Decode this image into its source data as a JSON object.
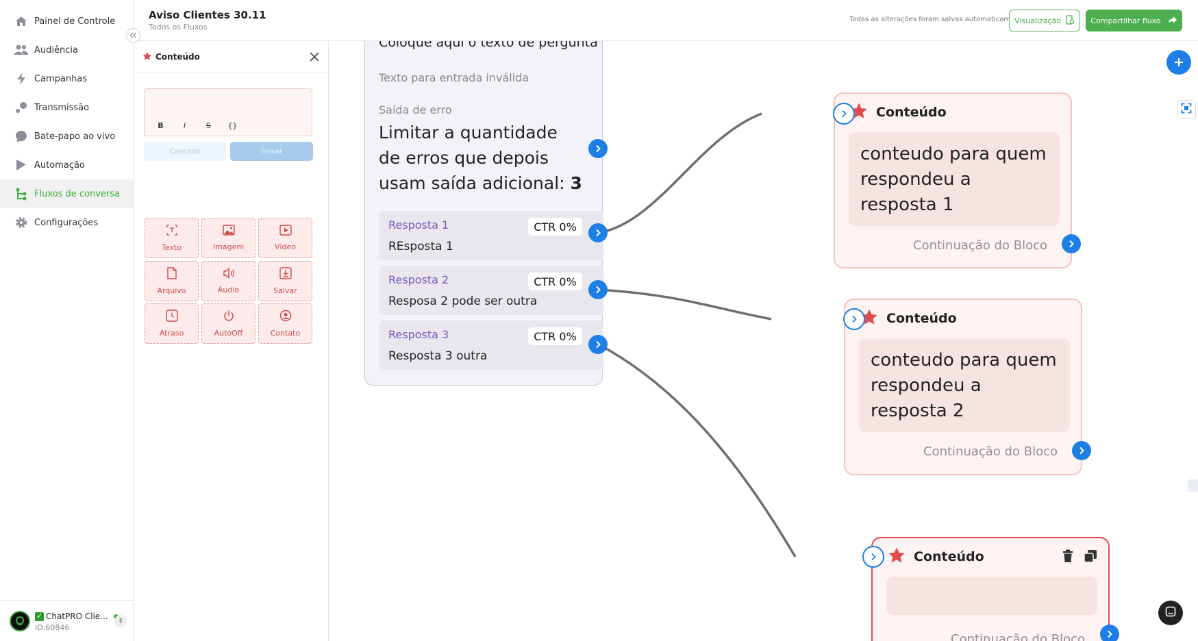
{
  "header": {
    "title": "Aviso Clientes 30.11",
    "breadcrumb": "Todos os Fluxos",
    "autosave": "Todas as alterações foram salvas automaticamente",
    "preview_label": "Visualização",
    "share_label": "Compartilhar fluxo"
  },
  "sidebar": {
    "items": [
      {
        "label": "Painel de Controle",
        "icon": "home-icon"
      },
      {
        "label": "Audiência",
        "icon": "people-icon"
      },
      {
        "label": "Campanhas",
        "icon": "bolt-icon"
      },
      {
        "label": "Transmissão",
        "icon": "broadcast-icon"
      },
      {
        "label": "Bate-papo ao vivo",
        "icon": "chat-bubble-icon"
      },
      {
        "label": "Automação",
        "icon": "play-flag-icon"
      },
      {
        "label": "Fluxos de conversa",
        "icon": "flow-icon",
        "active": true
      },
      {
        "label": "Configurações",
        "icon": "gear-icon"
      }
    ],
    "account": {
      "name": "ChatPRO Clie...",
      "id": "ID:60846",
      "status": "online"
    }
  },
  "panel": {
    "title": "Conteúdo",
    "editor_tools": [
      "B",
      "I",
      "S",
      "{}"
    ],
    "cancel_label": "Cancelar",
    "save_label": "Salvar",
    "blocks": [
      {
        "label": "Texto",
        "icon": "text-icon"
      },
      {
        "label": "Imagem",
        "icon": "image-icon"
      },
      {
        "label": "Vídeo",
        "icon": "video-icon"
      },
      {
        "label": "Arquivo",
        "icon": "file-icon"
      },
      {
        "label": "Áudio",
        "icon": "audio-icon"
      },
      {
        "label": "Salvar",
        "icon": "download-icon"
      },
      {
        "label": "Atraso",
        "icon": "clock-icon"
      },
      {
        "label": "AutoOff",
        "icon": "power-icon"
      },
      {
        "label": "Contato",
        "icon": "contact-icon"
      }
    ]
  },
  "question_card": {
    "question_text": "Coloque aqui o texto de pergunta",
    "invalid_text": "Texto para entrada inválida",
    "error_label": "Saída de erro",
    "limit_text": "Limitar a quantidade de erros que depois usam saída adicional:",
    "limit_value": "3",
    "answers": [
      {
        "name": "Resposta 1",
        "value": "REsposta 1",
        "ctr": "CTR 0%"
      },
      {
        "name": "Resposta 2",
        "value": "Resposa 2 pode ser outra",
        "ctr": "CTR 0%"
      },
      {
        "name": "Resposta 3",
        "value": "Resposta 3 outra",
        "ctr": "CTR 0%"
      }
    ]
  },
  "content_cards": [
    {
      "title": "Conteúdo",
      "text": "conteudo para quem respondeu a resposta 1",
      "continuation": "Continuação do Bloco"
    },
    {
      "title": "Conteúdo",
      "text": "conteudo para quem respondeu a resposta 2",
      "continuation": "Continuação do Bloco"
    },
    {
      "title": "Conteúdo",
      "text": "",
      "continuation": "Continuação do Bloco",
      "selected": true
    }
  ],
  "colors": {
    "accent_green": "#4caf50",
    "port_blue": "#1d7fe6",
    "answer_purple": "#7b5ab8",
    "content_red": "#e24b4b"
  }
}
